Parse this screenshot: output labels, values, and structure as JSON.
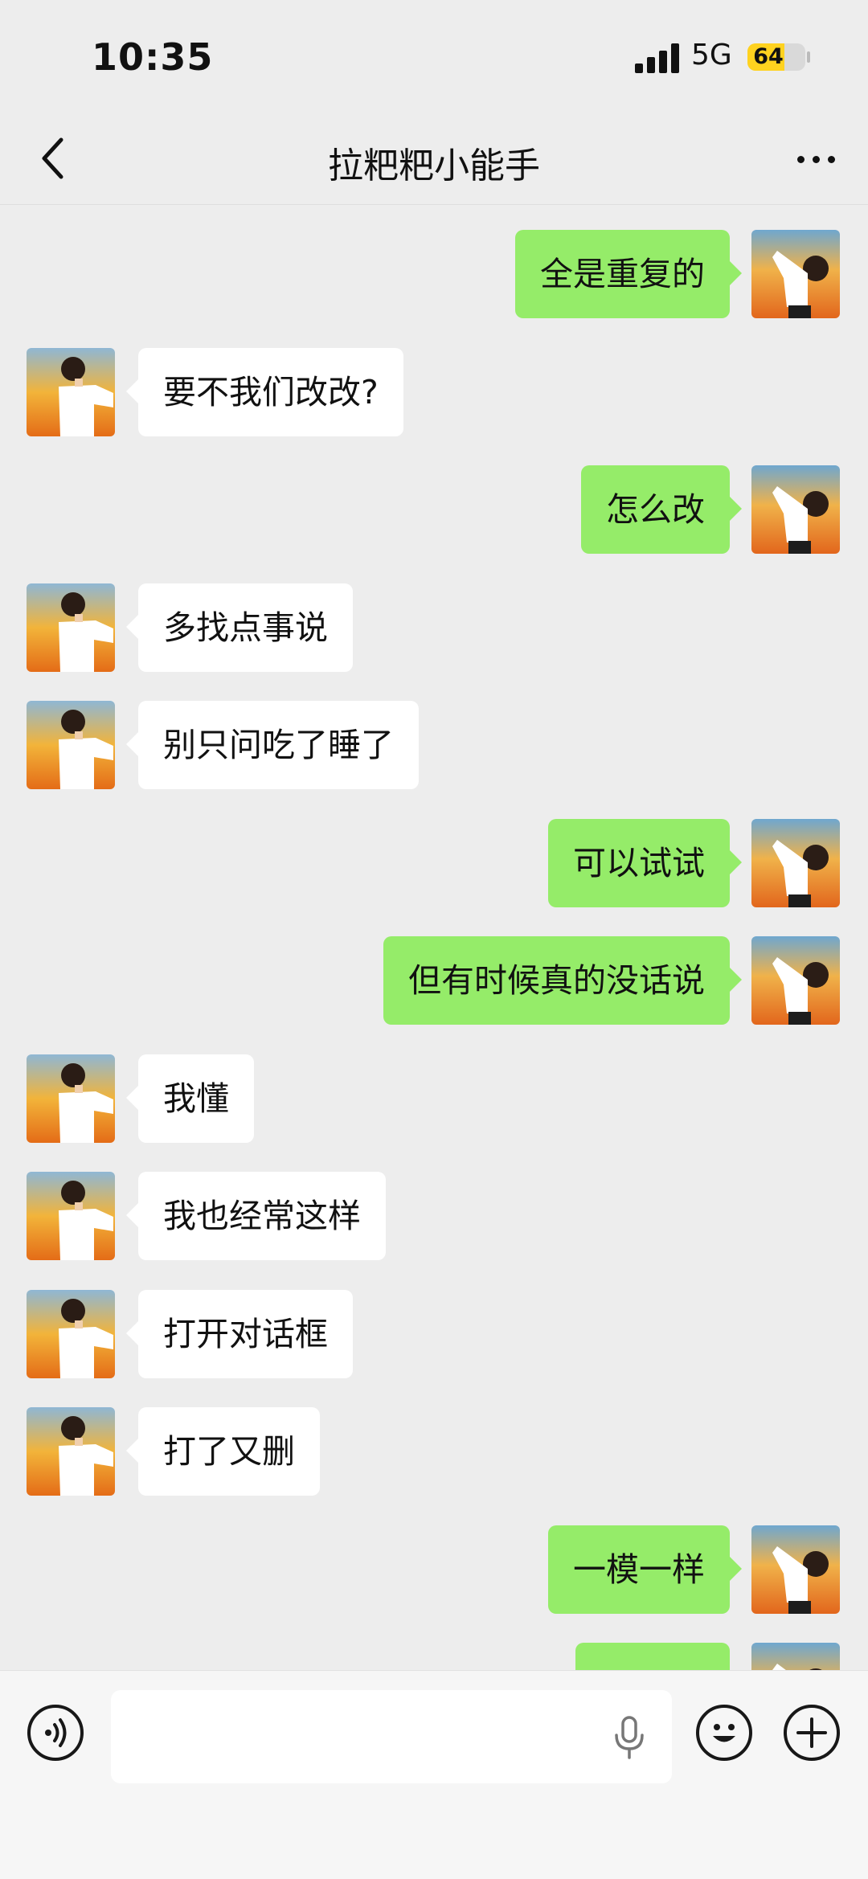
{
  "status_bar": {
    "time": "10:35",
    "network": "5G",
    "battery_percent": "64",
    "battery_level": 0.64,
    "battery_color": "#ffd21f"
  },
  "nav": {
    "back_icon": "chevron-left-icon",
    "title": "拉粑粑小能手",
    "more_icon": "more-dots-icon"
  },
  "colors": {
    "sent_bubble": "#95ec69",
    "received_bubble": "#ffffff",
    "background": "#ededed"
  },
  "messages": [
    {
      "side": "right",
      "text": "全是重复的"
    },
    {
      "side": "left",
      "text": "要不我们改改?"
    },
    {
      "side": "right",
      "text": "怎么改"
    },
    {
      "side": "left",
      "text": "多找点事说"
    },
    {
      "side": "left",
      "text": "别只问吃了睡了"
    },
    {
      "side": "right",
      "text": "可以试试"
    },
    {
      "side": "right",
      "text": "但有时候真的没话说"
    },
    {
      "side": "left",
      "text": "我懂"
    },
    {
      "side": "left",
      "text": "我也经常这样"
    },
    {
      "side": "left",
      "text": "打开对话框"
    },
    {
      "side": "left",
      "text": "打了又删"
    },
    {
      "side": "right",
      "text": "一模一样"
    },
    {
      "side": "right",
      "text": ""
    }
  ],
  "input_bar": {
    "voice_icon": "voice-mode-icon",
    "input_value": "",
    "mic_icon": "microphone-icon",
    "emoji_icon": "emoji-smile-icon",
    "plus_icon": "plus-icon"
  }
}
